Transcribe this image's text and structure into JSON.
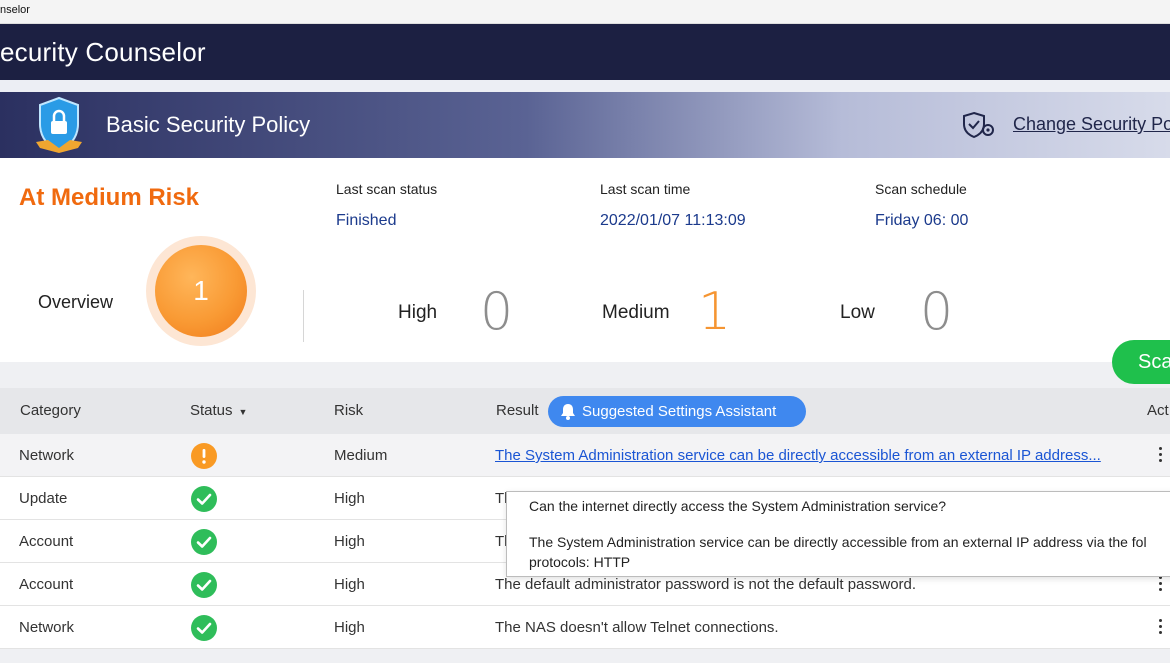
{
  "window": {
    "title": "nselor"
  },
  "app": {
    "title": "ecurity Counselor"
  },
  "policy": {
    "name": "Basic Security Policy",
    "change_link": "Change Security Po"
  },
  "summary": {
    "risk_level": "At Medium Risk",
    "last_scan_status_label": "Last scan status",
    "last_scan_status": "Finished",
    "last_scan_time_label": "Last scan time",
    "last_scan_time": "2022/01/07 11:13:09",
    "scan_schedule_label": "Scan schedule",
    "scan_schedule": "Friday 06: 00",
    "overview_label": "Overview",
    "overview_count": "1",
    "high_label": "High",
    "high_count": "0",
    "medium_label": "Medium",
    "medium_count": "1",
    "low_label": "Low",
    "low_count": "0",
    "scan_button": "Sca"
  },
  "colors": {
    "risk_orange": "#f06a0f",
    "ok_green": "#2fbd5a",
    "warn_orange": "#f99a24",
    "link_blue": "#1a55d4",
    "app_bar": "#1c2042",
    "assist_blue": "#3f88ef"
  },
  "table": {
    "headers": {
      "category": "Category",
      "status": "Status",
      "risk": "Risk",
      "result": "Result",
      "action": "Act"
    },
    "assistant_button": "Suggested Settings Assistant",
    "rows": [
      {
        "category": "Network",
        "status": "warning",
        "status_icon": "warning-icon",
        "risk": "Medium",
        "result": "The System Administration service can be directly accessible from an external IP address..."
      },
      {
        "category": "Update",
        "status": "ok",
        "status_icon": "check-icon",
        "risk": "High",
        "result": "Th"
      },
      {
        "category": "Account",
        "status": "ok",
        "status_icon": "check-icon",
        "risk": "High",
        "result": "Th"
      },
      {
        "category": "Account",
        "status": "ok",
        "status_icon": "check-icon",
        "risk": "High",
        "result": "The default administrator password is not the default password."
      },
      {
        "category": "Network",
        "status": "ok",
        "status_icon": "check-icon",
        "risk": "High",
        "result": "The NAS doesn't allow Telnet connections."
      }
    ]
  },
  "tooltip": {
    "question": "Can the internet directly access the System Administration service?",
    "answer_line1": "The System Administration service can be directly accessible from an external IP address via the fol",
    "answer_line2": "protocols: HTTP"
  }
}
